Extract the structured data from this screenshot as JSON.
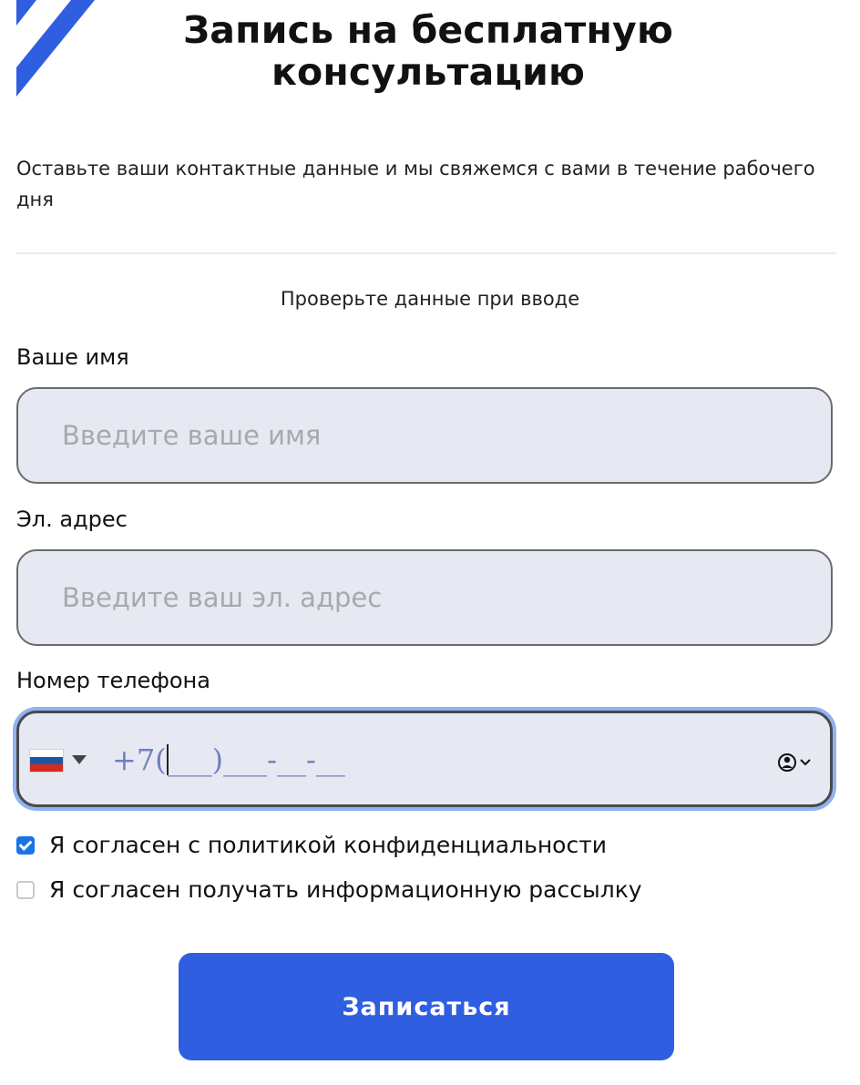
{
  "form": {
    "title_line1": "Запись на бесплатную",
    "title_line2": "консультацию",
    "subtitle": "Оставьте ваши контактные данные и мы свяжемся с вами в течение рабочего дня",
    "hint": "Проверьте данные при вводе",
    "name": {
      "label": "Ваше имя",
      "placeholder": "Введите ваше имя",
      "value": ""
    },
    "email": {
      "label": "Эл. адрес",
      "placeholder": "Введите ваш эл. адрес",
      "value": ""
    },
    "phone": {
      "label": "Номер телефона",
      "country_icon": "russia-flag-icon",
      "prefix": "+7(",
      "mask_rest": "___)___-__-__"
    },
    "privacy_consent": {
      "label": "Я согласен с политикой конфиденциальности",
      "checked": true
    },
    "newsletter_consent": {
      "label": "Я согласен получать информационную рассылку",
      "checked": false
    },
    "submit_label": "Записаться"
  },
  "colors": {
    "accent": "#2f5ee0",
    "field_bg": "#e6e9f2",
    "focus_ring": "#8fb2f2",
    "checkbox_checked": "#1a73e8",
    "phone_mask": "#6e7fbf",
    "flag_white": "#ffffff",
    "flag_blue": "#1c57a7",
    "flag_red": "#d52b1e"
  }
}
